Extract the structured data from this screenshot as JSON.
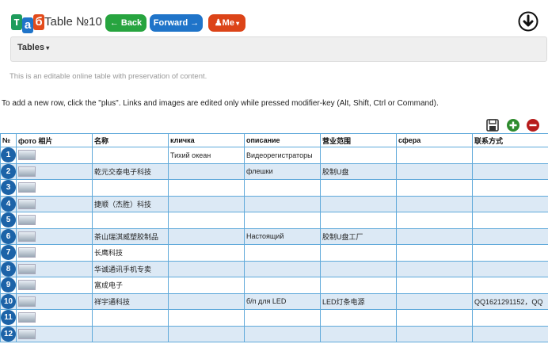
{
  "app": {
    "logo_letters": [
      "т",
      "а",
      "б"
    ],
    "logo_colors": [
      "#1e9c5c",
      "#1f74c9",
      "#e34b1b"
    ],
    "title": "Table №10"
  },
  "toolbar": {
    "back_label": "← Back",
    "forward_label": "Forward →",
    "me_label": "Me",
    "back_color": "#27a43f",
    "forward_color": "#1f74c9",
    "me_color": "#dc4418",
    "download_icon": "download-circle-icon"
  },
  "nav": {
    "tables_label": "Tables"
  },
  "page": {
    "description": "This is an editable online table with preservation of content.",
    "instructions": "To add a new row, click the \"plus\". Links and images are edited only while pressed modifier-key (Alt, Shift, Ctrl or Command)."
  },
  "actions": {
    "save_icon": "save-icon",
    "add_icon": "add-row-icon",
    "remove_icon": "remove-row-icon",
    "add_color": "#2e8b2e",
    "remove_color": "#b71c1c"
  },
  "table": {
    "columns": [
      "№",
      "фото 相片",
      "名称",
      "кличка",
      "описание",
      "营业范围",
      "сфера",
      "联系方式"
    ],
    "rows": [
      {
        "num": "1",
        "photo": "photo",
        "name": "",
        "nick": "Тихий океан",
        "desc": "Видеорегистраторы",
        "scope": "",
        "sphere": "",
        "contact": ""
      },
      {
        "num": "2",
        "photo": "photo",
        "name": "乾元交泰电子科技",
        "nick": "",
        "desc": "флешки",
        "scope": "胶制U盘",
        "sphere": "",
        "contact": ""
      },
      {
        "num": "3",
        "photo": "photo",
        "name": "",
        "nick": "",
        "desc": "",
        "scope": "",
        "sphere": "",
        "contact": ""
      },
      {
        "num": "4",
        "photo": "photo",
        "name": "捷顺（杰胜）科技",
        "nick": "",
        "desc": "",
        "scope": "",
        "sphere": "",
        "contact": ""
      },
      {
        "num": "5",
        "photo": "photo",
        "name": "",
        "nick": "",
        "desc": "",
        "scope": "",
        "sphere": "",
        "contact": ""
      },
      {
        "num": "6",
        "photo": "photo",
        "name": "茶山瑞淇威塑胶制品",
        "nick": "",
        "desc": "Настоящий",
        "scope": "胶制U盘工厂",
        "sphere": "",
        "contact": ""
      },
      {
        "num": "7",
        "photo": "photo",
        "name": "长鹰科技",
        "nick": "",
        "desc": "",
        "scope": "",
        "sphere": "",
        "contact": ""
      },
      {
        "num": "8",
        "photo": "photo",
        "name": "华诚通讯手机专卖",
        "nick": "",
        "desc": "",
        "scope": "",
        "sphere": "",
        "contact": ""
      },
      {
        "num": "9",
        "photo": "photo",
        "name": "富成电子",
        "nick": "",
        "desc": "",
        "scope": "",
        "sphere": "",
        "contact": ""
      },
      {
        "num": "10",
        "photo": "photo",
        "name": "祥宇通科技",
        "nick": "",
        "desc": "б/п для LED",
        "scope": "LED灯条电源",
        "sphere": "",
        "contact": "QQ1621291152，QQ"
      },
      {
        "num": "11",
        "photo": "photo",
        "name": "",
        "nick": "",
        "desc": "",
        "scope": "",
        "sphere": "",
        "contact": ""
      },
      {
        "num": "12",
        "photo": "photo",
        "name": "",
        "nick": "",
        "desc": "",
        "scope": "",
        "sphere": "",
        "contact": ""
      }
    ]
  }
}
